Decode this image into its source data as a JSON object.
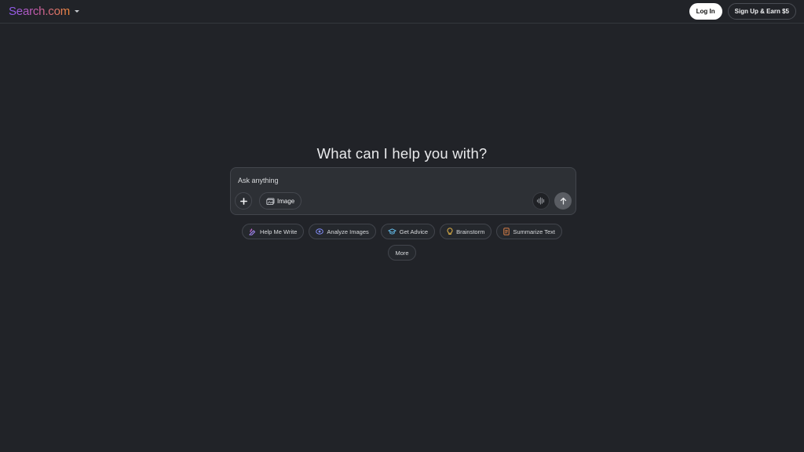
{
  "header": {
    "logo_text": "Search.com",
    "login_label": "Log In",
    "signup_label": "Sign Up & Earn $5"
  },
  "main": {
    "heading": "What can I help you with?",
    "composer": {
      "placeholder": "Ask anything",
      "image_button_label": "Image"
    },
    "suggestions": [
      {
        "label": "Help Me Write",
        "icon": "pen-sparkle-icon",
        "color": "#a78bfa"
      },
      {
        "label": "Analyze Images",
        "icon": "eye-icon",
        "color": "#818cf8"
      },
      {
        "label": "Get Advice",
        "icon": "graduation-cap-icon",
        "color": "#67c3f3"
      },
      {
        "label": "Brainstorm",
        "icon": "lightbulb-icon",
        "color": "#f5c14b"
      },
      {
        "label": "Summarize Text",
        "icon": "document-icon",
        "color": "#f08a4b"
      }
    ],
    "more_label": "More"
  }
}
